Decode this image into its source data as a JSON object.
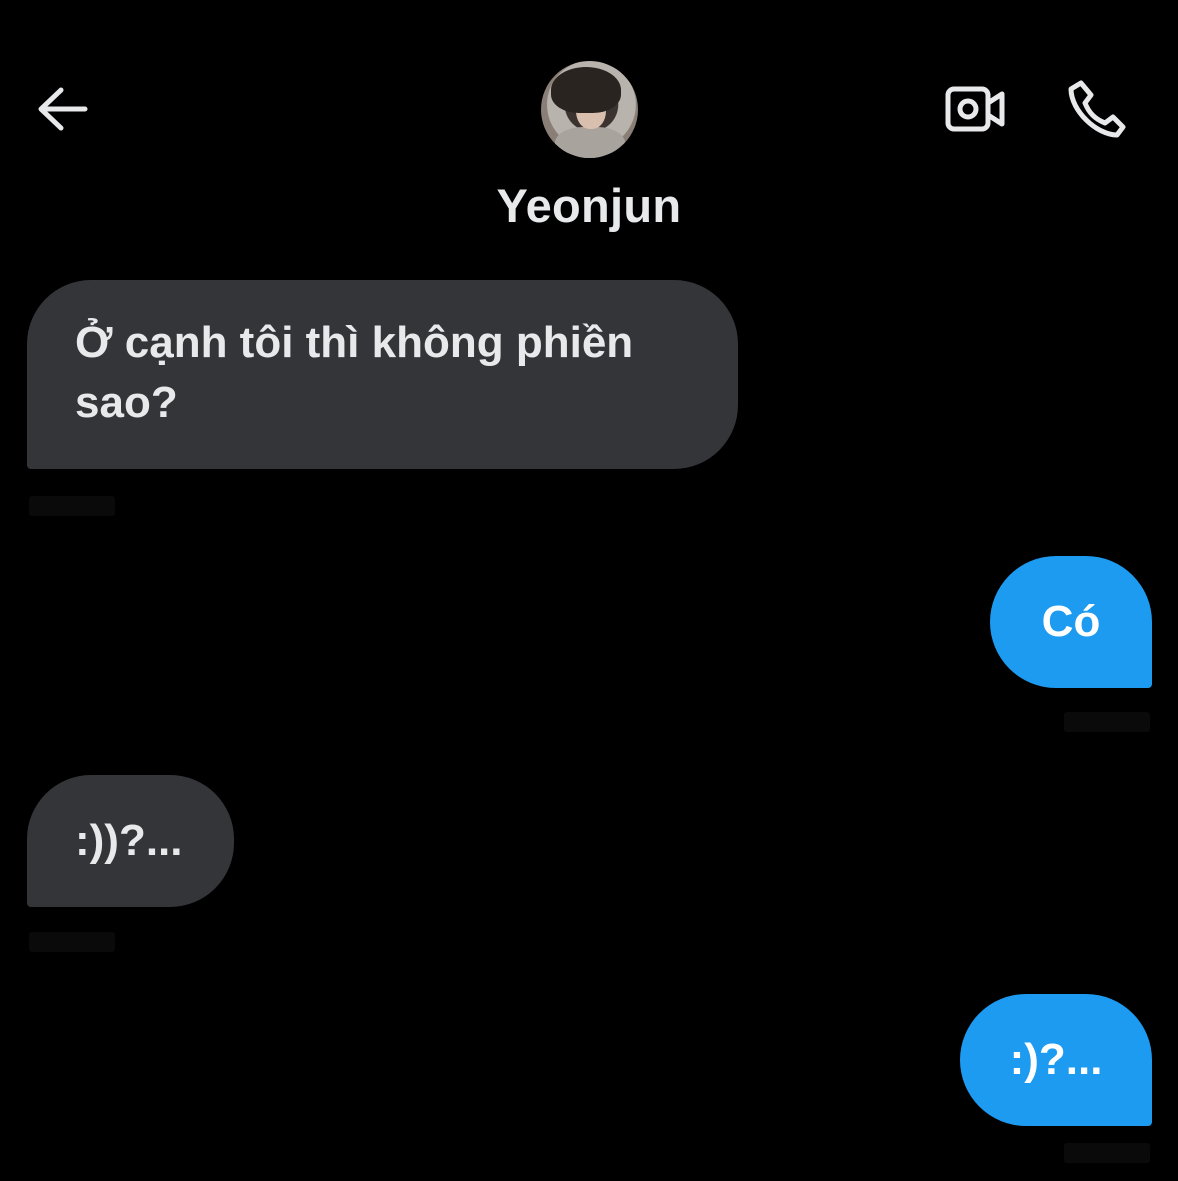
{
  "header": {
    "back_icon": "arrow-left-icon",
    "contact_name": "Yeonjun",
    "avatar_icon": "profile-photo",
    "video_icon": "video-camera-icon",
    "phone_icon": "phone-icon"
  },
  "messages": [
    {
      "direction": "incoming",
      "text": "Ở cạnh tôi thì không phiền sao?"
    },
    {
      "direction": "outgoing",
      "text": "Có"
    },
    {
      "direction": "incoming",
      "text": ":))?..."
    },
    {
      "direction": "outgoing",
      "text": ":)?..."
    }
  ],
  "colors": {
    "background": "#000000",
    "incoming_bubble": "#333539",
    "outgoing_bubble": "#1d9bf0",
    "text": "#e7e9ea"
  }
}
